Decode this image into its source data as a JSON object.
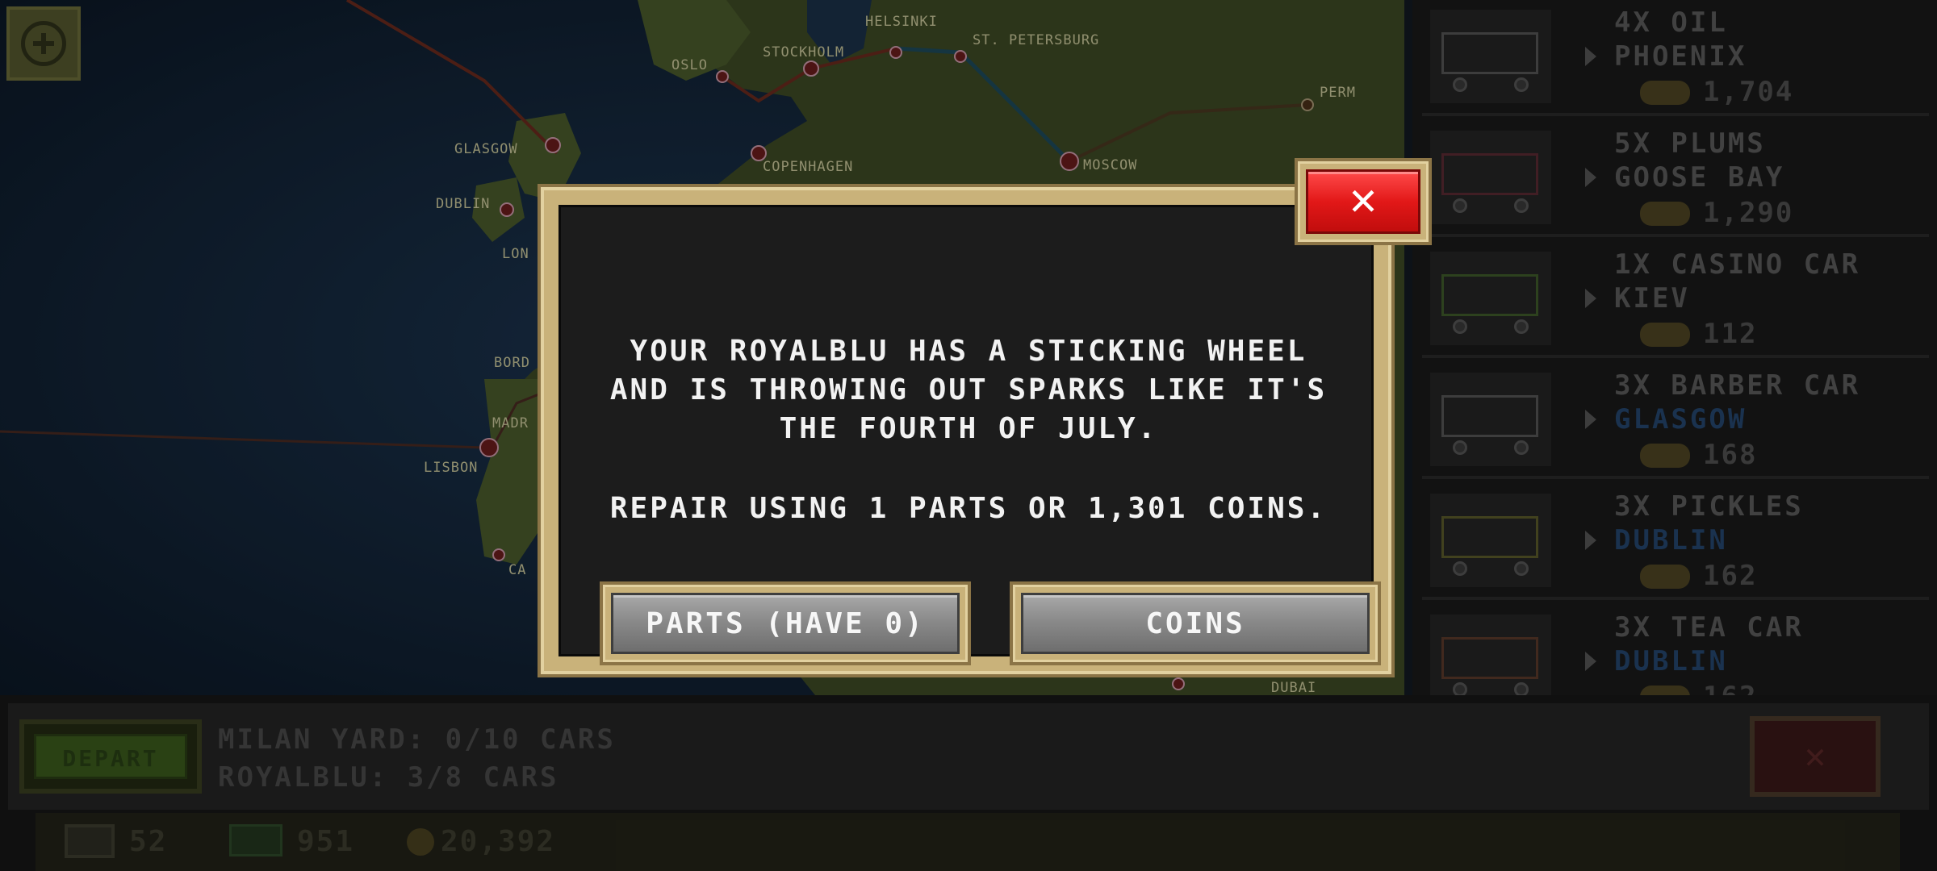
{
  "map": {
    "add_icon": "plus-circle-icon",
    "cities": [
      "HELSINKI",
      "ST. PETERSBURG",
      "OSLO",
      "STOCKHOLM",
      "PERM",
      "GLASGOW",
      "COPENHAGEN",
      "MOSCOW",
      "DUBLIN",
      "LON",
      "BORD",
      "MADR",
      "LISBON",
      "CA",
      "DUBAI"
    ]
  },
  "cargo_list": [
    {
      "qty": "4X OIL",
      "dest": "PHOENIX",
      "pay": "1,704",
      "dest_highlight": false
    },
    {
      "qty": "5X PLUMS",
      "dest": "GOOSE BAY",
      "pay": "1,290",
      "dest_highlight": false
    },
    {
      "qty": "1X CASINO CAR",
      "dest": "KIEV",
      "pay": "112",
      "dest_highlight": false
    },
    {
      "qty": "3X BARBER CAR",
      "dest": "GLASGOW",
      "pay": "168",
      "dest_highlight": true
    },
    {
      "qty": "3X PICKLES",
      "dest": "DUBLIN",
      "pay": "162",
      "dest_highlight": true
    },
    {
      "qty": "3X TEA CAR",
      "dest": "DUBLIN",
      "pay": "162",
      "dest_highlight": true
    }
  ],
  "bottom": {
    "depart_label": "DEPART",
    "yard_line": "MILAN YARD: 0/10 CARS",
    "train_line": "ROYALBLU: 3/8 CARS",
    "close_label": "✕",
    "stats": {
      "parts": "52",
      "cash": "951",
      "coins": "20,392"
    }
  },
  "dialog": {
    "message": "YOUR ROYALBLU HAS A STICKING WHEEL AND IS THROWING OUT SPARKS LIKE IT'S THE FOURTH OF JULY.",
    "repair_text": "REPAIR USING 1 PARTS OR 1,301 COINS.",
    "parts_button": "PARTS (HAVE 0)",
    "coins_button": "COINS",
    "close_label": "✕"
  },
  "colors": {
    "accent_red": "#e21818",
    "frame_gold": "#c9b27a",
    "button_gray": "#8a8a8a"
  }
}
